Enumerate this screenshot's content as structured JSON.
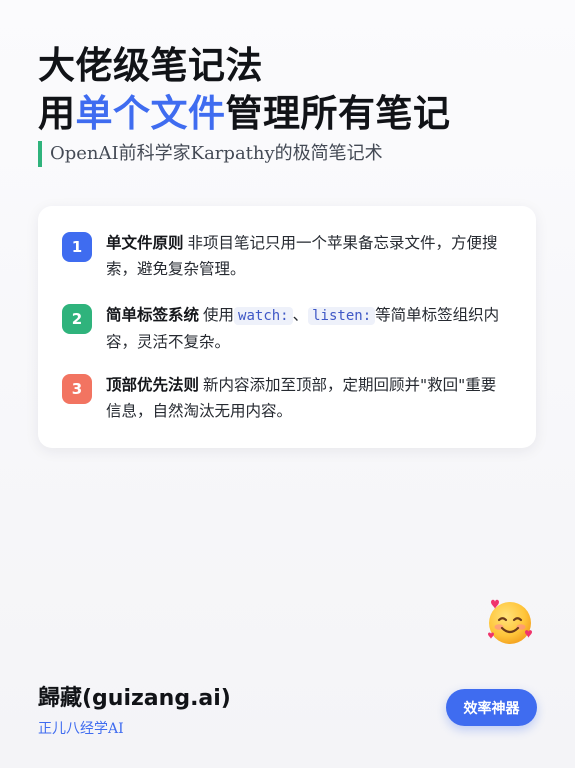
{
  "headline": {
    "line1": "大佬级笔记法",
    "line2_prefix": "用",
    "line2_accent": "单个文件",
    "line2_suffix": "管理所有笔记"
  },
  "subtitle": "OpenAI前科学家Karpathy的极简笔记术",
  "rules": [
    {
      "number": "1",
      "title": "单文件原则",
      "text": "非项目笔记只用一个苹果备忘录文件，方便搜索，避免复杂管理。"
    },
    {
      "number": "2",
      "title": "简单标签系统",
      "text_before": "使用",
      "tag1": "watch:",
      "separator": "、",
      "tag2": "listen:",
      "text_after": "等简单标签组织内容，灵活不复杂。"
    },
    {
      "number": "3",
      "title": "顶部优先法则",
      "text": "新内容添加至顶部，定期回顾并\"救回\"重要信息，自然淘汰无用内容。"
    }
  ],
  "footer": {
    "brand": "歸藏(guizang.ai)",
    "tagline": "正儿八经学AI",
    "button_label": "效率神器"
  },
  "icons": {
    "emoji": "smiling-face-with-hearts-icon"
  },
  "colors": {
    "accent_blue": "#3f6cf0",
    "accent_green": "#2fb37c",
    "badge_coral": "#f27461"
  }
}
